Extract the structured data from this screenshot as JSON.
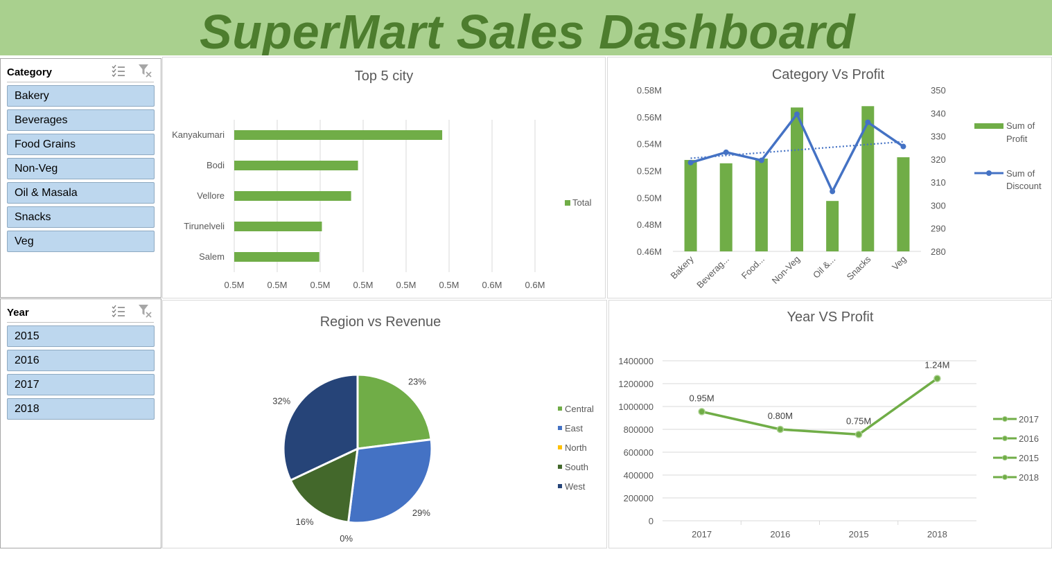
{
  "dashboard_title": "SuperMart Sales Dashboard",
  "colors": {
    "header_bg": "#a9d08e",
    "title": "#4d7d2e",
    "bar_green": "#70ad47",
    "line_blue": "#4472c4",
    "slicer_item": "#bdd7ee"
  },
  "category_slicer": {
    "title": "Category",
    "icons": [
      "multi-select-icon",
      "clear-filter-icon"
    ],
    "items": [
      "Bakery",
      "Beverages",
      "Food Grains",
      "Non-Veg",
      "Oil & Masala",
      "Snacks",
      "Veg"
    ]
  },
  "year_slicer": {
    "title": "Year",
    "icons": [
      "multi-select-icon",
      "clear-filter-icon"
    ],
    "items": [
      "2015",
      "2016",
      "2017",
      "2018"
    ]
  },
  "chart_data": [
    {
      "id": "top5",
      "type": "bar",
      "orientation": "horizontal",
      "title": "Top 5 city",
      "categories": [
        "Kanyakumari",
        "Bodi",
        "Vellore",
        "Tirunelveli",
        "Salem"
      ],
      "series": [
        {
          "name": "Total",
          "values": [
            0.5307,
            0.5209,
            0.5201,
            0.5167,
            0.5164
          ]
        }
      ],
      "xlim": [
        0.5065,
        0.5415
      ],
      "x_tick_labels": [
        "0.5M",
        "0.5M",
        "0.5M",
        "0.5M",
        "0.5M",
        "0.5M",
        "0.6M",
        "0.6M"
      ],
      "grid": true,
      "legend": "right"
    },
    {
      "id": "catprofit",
      "type": "bar",
      "title": "Category Vs Profit",
      "categories": [
        "Bakery",
        "Beverag...",
        "Food...",
        "Non-Veg",
        "Oil &...",
        "Snacks",
        "Veg"
      ],
      "series": [
        {
          "name": "Sum of Profit",
          "type": "bar",
          "axis": "left",
          "values": [
            0.528,
            0.5255,
            0.529,
            0.567,
            0.4975,
            0.568,
            0.53
          ]
        },
        {
          "name": "Sum of Discount",
          "type": "line",
          "axis": "right",
          "values": [
            318.5,
            323,
            319.5,
            339.5,
            306,
            336,
            325.5
          ]
        }
      ],
      "trendline": {
        "series": "Sum of Discount",
        "style": "dotted"
      },
      "y_left": {
        "range": [
          0.46,
          0.58
        ],
        "ticks": [
          "0.46M",
          "0.48M",
          "0.50M",
          "0.52M",
          "0.54M",
          "0.56M",
          "0.58M"
        ]
      },
      "y_right": {
        "range": [
          280,
          350
        ],
        "ticks": [
          "280",
          "290",
          "300",
          "310",
          "320",
          "330",
          "340",
          "350"
        ]
      },
      "legend": "right"
    },
    {
      "id": "region",
      "type": "pie",
      "title": "Region vs Revenue",
      "categories": [
        "Central",
        "East",
        "North",
        "South",
        "West"
      ],
      "values": [
        23,
        29,
        0,
        16,
        32
      ],
      "labels": [
        "23%",
        "29%",
        "0%",
        "16%",
        "32%"
      ],
      "colors": [
        "#70ad47",
        "#4472c4",
        "#ffc000",
        "#43682b",
        "#264478"
      ],
      "legend": "right"
    },
    {
      "id": "yearprofit",
      "type": "line",
      "title": "Year VS Profit",
      "categories": [
        "2017",
        "2016",
        "2015",
        "2018"
      ],
      "values": [
        955000,
        800000,
        755000,
        1245000
      ],
      "data_labels": [
        "0.95M",
        "0.80M",
        "0.75M",
        "1.24M"
      ],
      "ylim": [
        0,
        1400000
      ],
      "y_ticks": [
        "0",
        "200000",
        "400000",
        "600000",
        "800000",
        "1000000",
        "1200000",
        "1400000"
      ],
      "legend_entries": [
        "2017",
        "2016",
        "2015",
        "2018"
      ],
      "grid": true,
      "legend": "right"
    }
  ]
}
